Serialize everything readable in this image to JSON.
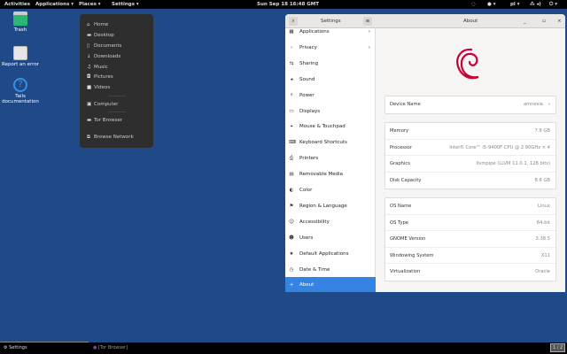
{
  "topbar": {
    "activities": "Activities",
    "applications": "Applications ▾",
    "places": "Places ▾",
    "settings": "Settings ▾",
    "clock": "Sun Sep 18  16:48 GMT",
    "keyboard": "pl ▾"
  },
  "desktop": [
    {
      "label": "Trash"
    },
    {
      "label": "Report an error"
    },
    {
      "label": "Tails documentation"
    }
  ],
  "places_menu": [
    "Home",
    "Desktop",
    "Documents",
    "Downloads",
    "Music",
    "Pictures",
    "Videos",
    "Computer",
    "Tor Browser",
    "Browse Network"
  ],
  "window": {
    "left_title": "Settings",
    "right_title": "About"
  },
  "sidebar": [
    "Applications",
    "Privacy",
    "Sharing",
    "Sound",
    "Power",
    "Displays",
    "Mouse & Touchpad",
    "Keyboard Shortcuts",
    "Printers",
    "Removable Media",
    "Color",
    "Region & Language",
    "Accessibility",
    "Users",
    "Default Applications",
    "Date & Time",
    "About"
  ],
  "about": {
    "device": {
      "label": "Device Name",
      "value": "amnesia"
    },
    "hardware": [
      {
        "label": "Memory",
        "value": "7.8 GB"
      },
      {
        "label": "Processor",
        "value": "Intel® Core™ i5-9400F CPU @ 2.90GHz × 4"
      },
      {
        "label": "Graphics",
        "value": "llvmpipe (LLVM 11.0.1, 128 bits)"
      },
      {
        "label": "Disk Capacity",
        "value": "8.6 GB"
      }
    ],
    "software": [
      {
        "label": "OS Name",
        "value": "Linux"
      },
      {
        "label": "OS Type",
        "value": "64-bit"
      },
      {
        "label": "GNOME Version",
        "value": "3.38.5"
      },
      {
        "label": "Windowing System",
        "value": "X11"
      },
      {
        "label": "Virtualization",
        "value": "Oracle"
      }
    ]
  },
  "taskbar": {
    "settings": "Settings",
    "tor": "[Tor Browser]",
    "workspace": "1 / 2"
  },
  "colors": {
    "desktop": "#204a87",
    "accent": "#3584e4",
    "debian": "#c70036"
  }
}
